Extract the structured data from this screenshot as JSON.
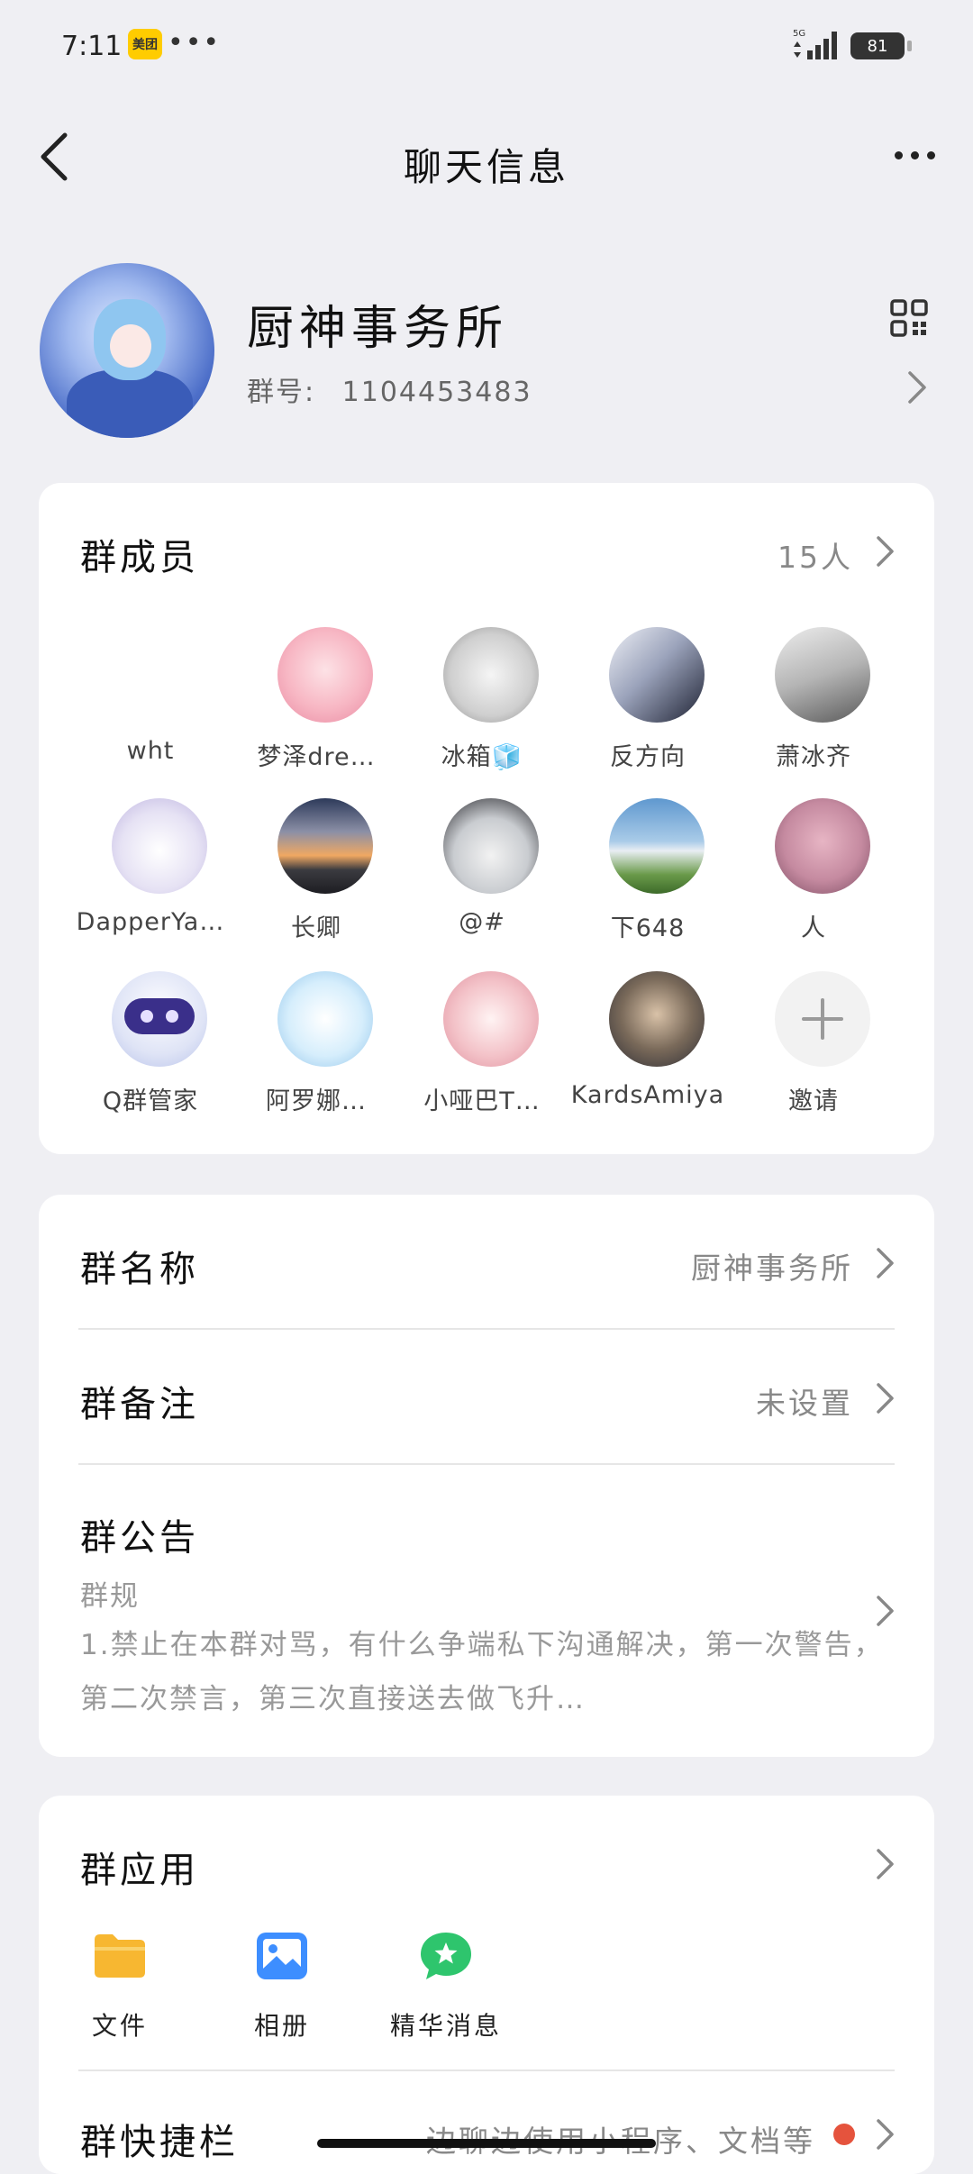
{
  "status_bar": {
    "time": "7:11",
    "app_badge": "美团",
    "more": "•••",
    "network": "5G",
    "battery": "81"
  },
  "nav": {
    "title": "聊天信息"
  },
  "group": {
    "name": "厨神事务所",
    "id_label": "群号:",
    "id_value": "1104453483"
  },
  "members_section": {
    "title": "群成员",
    "count": "15人",
    "members": [
      {
        "name": "wht",
        "avatar_color": "#ffffff"
      },
      {
        "name": "梦泽dre…",
        "avatar_color": "#f7c7cf"
      },
      {
        "name": "冰箱🧊",
        "avatar_color": "#d8d8d8"
      },
      {
        "name": "反方向",
        "avatar_color": "#3a3f52"
      },
      {
        "name": "萧冰齐",
        "avatar_color": "#9a9a9a"
      },
      {
        "name": "DapperYa…",
        "avatar_color": "#e9e4f5"
      },
      {
        "name": "长卿",
        "avatar_color": "#e9a868"
      },
      {
        "name": "@#",
        "avatar_color": "#cfd3d8"
      },
      {
        "name": "下648",
        "avatar_color": "#7db2d9"
      },
      {
        "name": "人",
        "avatar_color": "#c78ea0"
      },
      {
        "name": "Q群管家",
        "avatar_color": "#3a2f8a"
      },
      {
        "name": "阿罗娜…",
        "avatar_color": "#d6eefc"
      },
      {
        "name": "小哑巴T…",
        "avatar_color": "#f3c2c8"
      },
      {
        "name": "KardsAmiya",
        "avatar_color": "#4a4a52"
      },
      {
        "name": "邀请",
        "avatar_color": "#f0f0f0"
      }
    ]
  },
  "settings": {
    "group_name_label": "群名称",
    "group_name_value": "厨神事务所",
    "group_remark_label": "群备注",
    "group_remark_value": "未设置",
    "notice_label": "群公告",
    "notice_subtitle": "群规",
    "notice_text": "1.禁止在本群对骂，有什么争端私下沟通解决，第一次警告，第二次禁言，第三次直接送去做飞升…"
  },
  "apps_section": {
    "title": "群应用",
    "apps": [
      {
        "label": "文件",
        "icon": "folder-icon",
        "color": "#f7b731"
      },
      {
        "label": "相册",
        "icon": "album-icon",
        "color": "#3d8eff"
      },
      {
        "label": "精华消息",
        "icon": "star-chat-icon",
        "color": "#2ec56d"
      }
    ],
    "shortcut_label": "群快捷栏",
    "shortcut_value": "边聊边使用小程序、文档等"
  }
}
